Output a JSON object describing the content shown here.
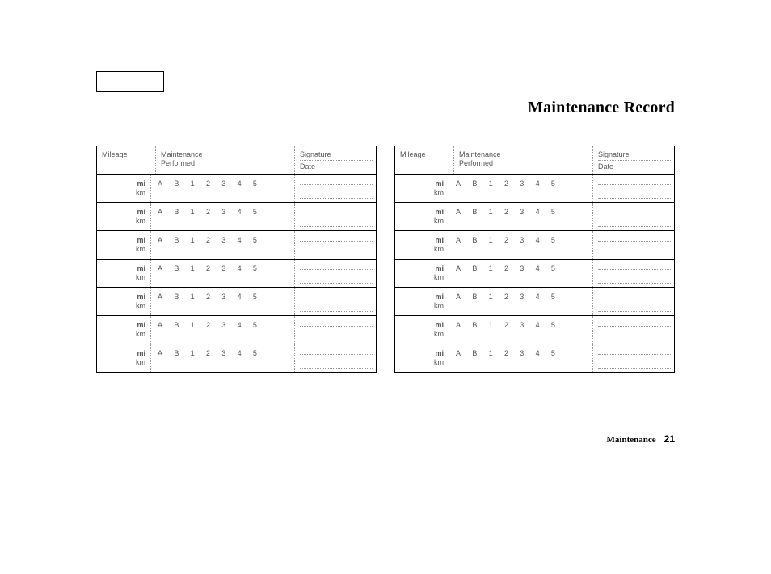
{
  "title": "Maintenance Record",
  "footer": {
    "section": "Maintenance",
    "page": "21"
  },
  "headers": {
    "mileage": "Mileage",
    "maintenance_l1": "Maintenance",
    "maintenance_l2": "Performed",
    "signature": "Signature",
    "date": "Date"
  },
  "units": {
    "mi": "mi",
    "km": "km"
  },
  "codes": [
    "A",
    "B",
    "1",
    "2",
    "3",
    "4",
    "5"
  ],
  "rows_per_table": 7,
  "tables": 2
}
